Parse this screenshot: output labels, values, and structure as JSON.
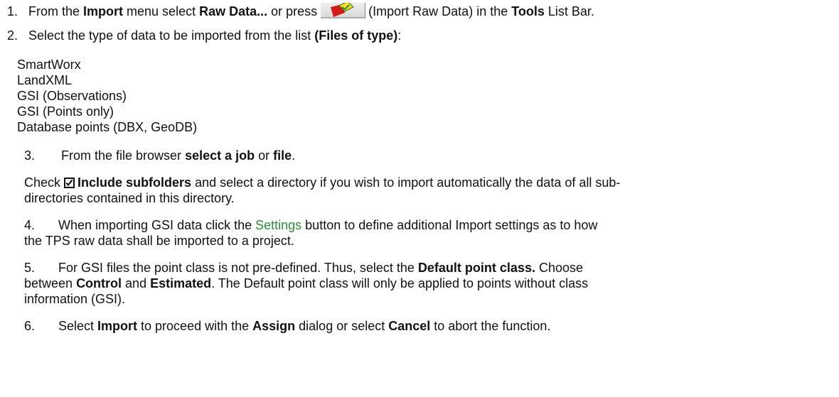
{
  "step1": {
    "number": "1.",
    "text_a": "From the ",
    "menu": "Import",
    "text_b": " menu select ",
    "command": "Raw Data...",
    "text_c": " or press",
    "icon_name": "import-raw-data-icon",
    "text_d": "(Import Raw Data) in the ",
    "bar": "Tools",
    "text_e": " List Bar."
  },
  "step2": {
    "number": "2.",
    "text_a": "Select the type of data to be imported from the list ",
    "files_of_type": "(Files of type)",
    "text_b": ":"
  },
  "file_types": [
    "SmartWorx",
    "LandXML",
    "GSI (Observations)",
    "GSI (Points only)",
    "Database points (DBX, GeoDB)"
  ],
  "step3": {
    "number": "3.",
    "text_a": "From the file browser ",
    "select_job": "select a job",
    "text_b": " or ",
    "file": "file",
    "text_c": "."
  },
  "subfolders": {
    "text_a": "Check",
    "checkbox_icon": "checked-checkbox-icon",
    "option": "Include subfolders",
    "text_b": " and select a directory if you wish to import automatically the data of all sub-",
    "line2": "directories contained in this directory."
  },
  "step4": {
    "number": "4.",
    "text_a": "When importing GSI data click the ",
    "settings_link": "Settings",
    "text_b": " button to define additional Import settings as to how",
    "line2": "the TPS raw data shall be imported to a project."
  },
  "step5": {
    "number": "5.",
    "text_a": "For GSI files the point class is not pre-defined. Thus, select the ",
    "default_point_class": "Default point class.",
    "text_b": " Choose",
    "line2_a": "between ",
    "control": "Control",
    "line2_b": " and ",
    "estimated": "Estimated",
    "line2_c": ". The Default point class will only be applied to points without class",
    "line3": "information (GSI)."
  },
  "step6": {
    "number": "6.",
    "text_a": "Select ",
    "import": "Import",
    "text_b": " to proceed with the ",
    "assign": "Assign",
    "text_c": " dialog or select ",
    "cancel": "Cancel",
    "text_d": " to abort the function."
  },
  "colors": {
    "text": "#111111",
    "link": "#2e8b3a",
    "icon_red": "#d41a1a",
    "icon_yellow": "#f5e020"
  }
}
